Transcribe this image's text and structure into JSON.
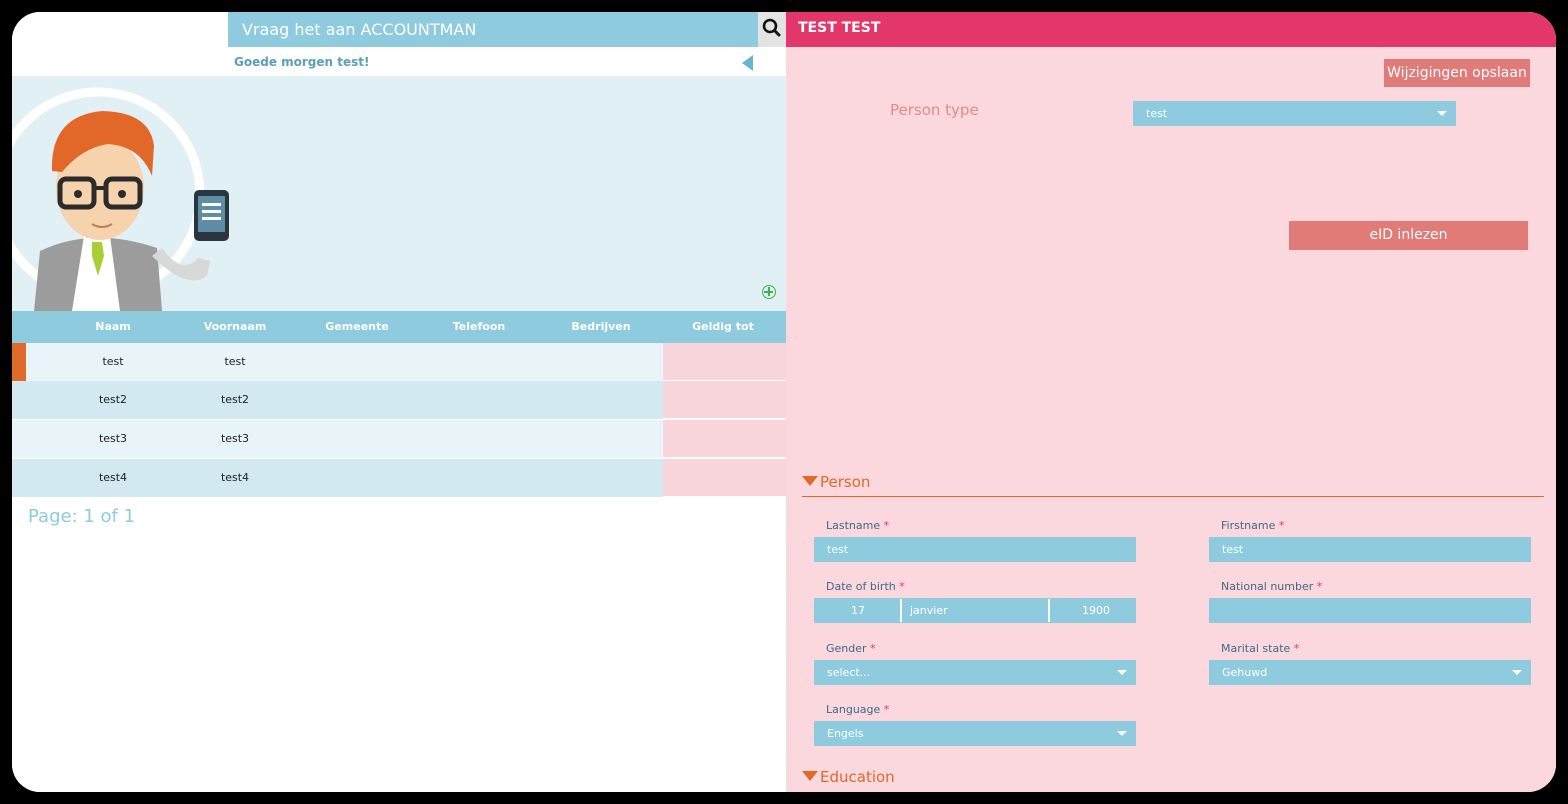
{
  "search": {
    "placeholder": "Vraag het aan ACCOUNTMAN"
  },
  "greeting": "Goede morgen test!",
  "table": {
    "headers": [
      "Naam",
      "Voornaam",
      "Gemeente",
      "Telefoon",
      "Bedrijven",
      "Geldig tot"
    ],
    "rows": [
      {
        "naam": "test",
        "voornaam": "test"
      },
      {
        "naam": "test2",
        "voornaam": "test2"
      },
      {
        "naam": "test3",
        "voornaam": "test3"
      },
      {
        "naam": "test4",
        "voornaam": "test4"
      }
    ],
    "pager": "Page: 1 of 1"
  },
  "detail": {
    "title": "TEST TEST",
    "save_label": "Wijzigingen opslaan",
    "person_type_label": "Person type",
    "person_type_value": "test",
    "eid_label": "eID inlezen",
    "sections": {
      "person": "Person",
      "education": "Education"
    },
    "fields": {
      "lastname": {
        "label": "Lastname",
        "value": "test"
      },
      "firstname": {
        "label": "Firstname",
        "value": "test"
      },
      "dob": {
        "label": "Date of birth",
        "day": "17",
        "month": "janvier",
        "year": "1900"
      },
      "national_number": {
        "label": "National number",
        "value": ""
      },
      "gender": {
        "label": "Gender",
        "value": "select..."
      },
      "marital_state": {
        "label": "Marital state",
        "value": "Gehuwd"
      },
      "language": {
        "label": "Language",
        "value": "Engels"
      }
    },
    "required_mark": "*"
  },
  "colors": {
    "accent_blue": "#8ecbdf",
    "header_pink": "#e3366a",
    "panel_pink": "#fad8de",
    "button_salmon": "#e07b78",
    "section_orange": "#e06a2a"
  }
}
